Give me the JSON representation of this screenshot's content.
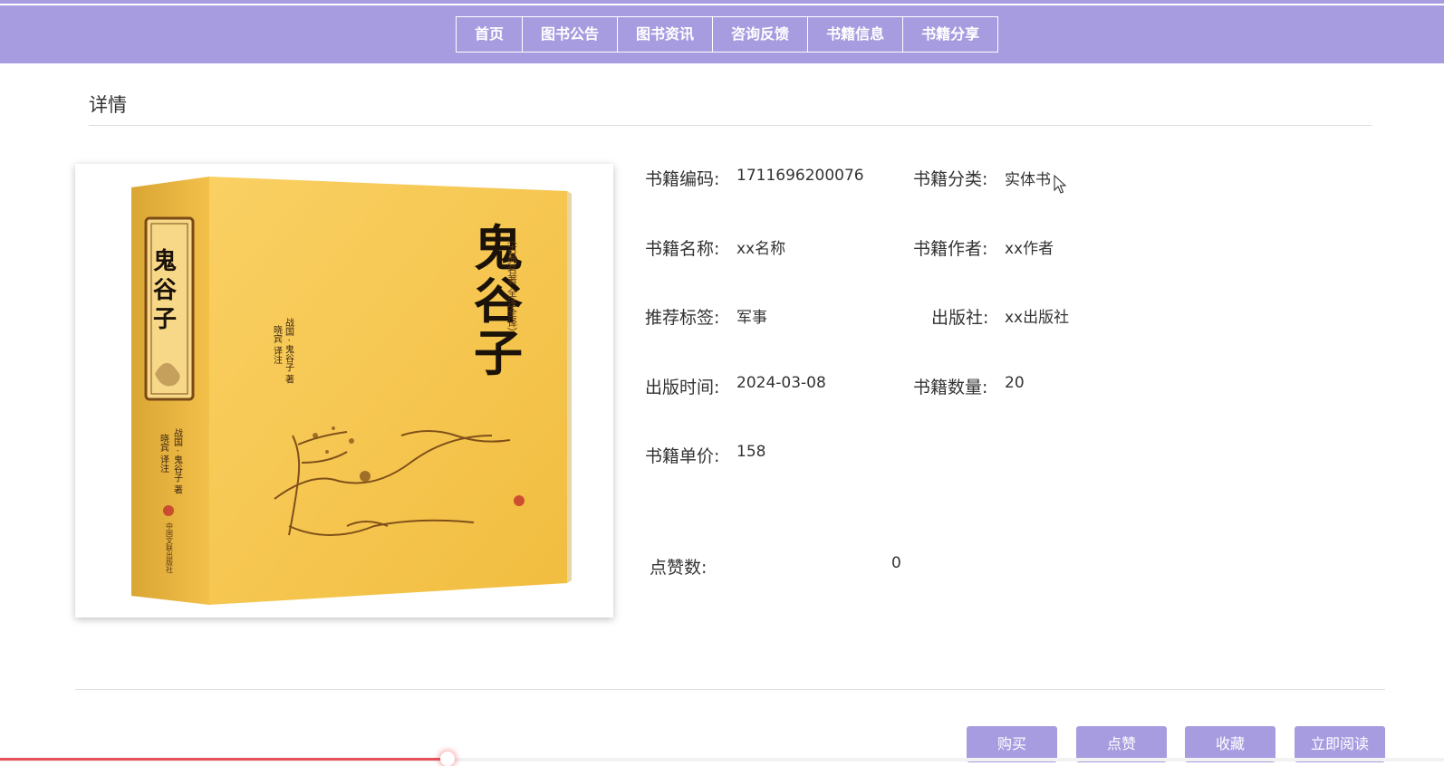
{
  "nav": {
    "items": [
      "首页",
      "图书公告",
      "图书资讯",
      "咨询反馈",
      "书籍信息",
      "书籍分享"
    ]
  },
  "page": {
    "title": "详情"
  },
  "book": {
    "cover_title": "鬼谷子",
    "cover_series": "（古典名著 全注全译）",
    "cover_author": "战国 · 鬼谷子 著",
    "cover_translator": "晓宾 译注",
    "cover_spine_author": "战国 · 鬼谷子 著",
    "cover_spine_translator": "晓宾 译注",
    "cover_publisher": "中国文联出版社",
    "fields": {
      "code": {
        "label": "书籍编码:",
        "value": "1711696200076"
      },
      "category": {
        "label": "书籍分类:",
        "value": "实体书"
      },
      "name": {
        "label": "书籍名称:",
        "value": "xx名称"
      },
      "author": {
        "label": "书籍作者:",
        "value": "xx作者"
      },
      "tag": {
        "label": "推荐标签:",
        "value": "军事"
      },
      "publisher": {
        "label": "出版社:",
        "value": "xx出版社"
      },
      "pub_date": {
        "label": "出版时间:",
        "value": "2024-03-08"
      },
      "quantity": {
        "label": "书籍数量:",
        "value": "20"
      },
      "price": {
        "label": "书籍单价:",
        "value": "158"
      },
      "likes": {
        "label": "点赞数:",
        "value": "0"
      }
    }
  },
  "actions": {
    "buy": "购买",
    "like": "点赞",
    "favorite": "收藏",
    "read": "立即阅读"
  },
  "progress": {
    "fraction": 0.31
  },
  "colors": {
    "accent": "#a89ce0",
    "cover_yellow": "#f7c44a",
    "progress": "#e8505b"
  }
}
